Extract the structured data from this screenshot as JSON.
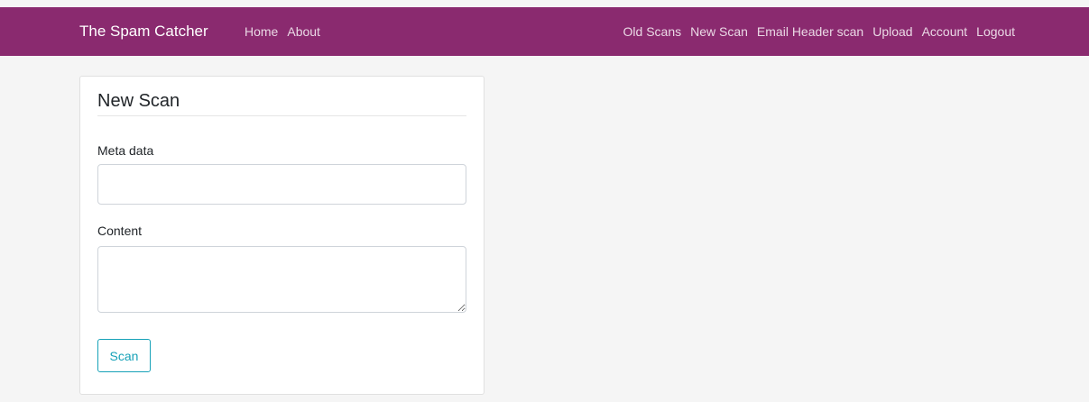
{
  "navbar": {
    "brand": "The Spam Catcher",
    "left_links": [
      "Home",
      "About"
    ],
    "right_links": [
      "Old Scans",
      "New Scan",
      "Email Header scan",
      "Upload",
      "Account",
      "Logout"
    ],
    "background_color": "#8a2a6f"
  },
  "form": {
    "title": "New Scan",
    "meta_label": "Meta data",
    "meta_value": "",
    "content_label": "Content",
    "content_value": "",
    "scan_button": "Scan",
    "button_color": "#17a2b8"
  }
}
